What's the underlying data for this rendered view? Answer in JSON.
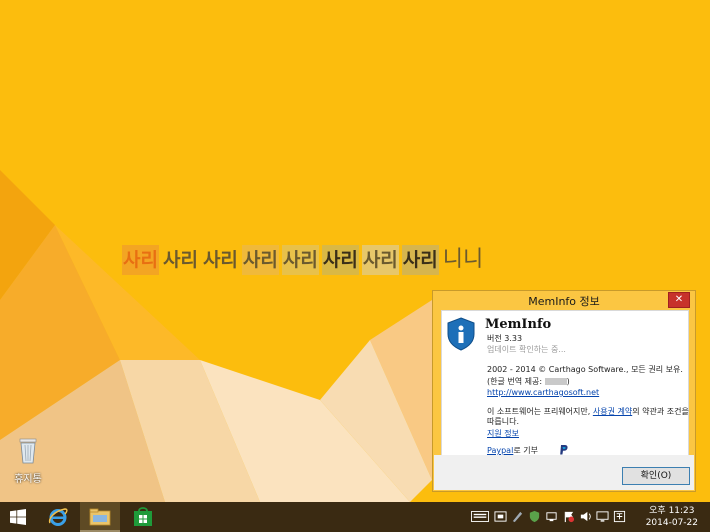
{
  "desktop": {
    "watermark_words": [
      "사리",
      "사리",
      "사리",
      "사리",
      "사리",
      "사리",
      "사리",
      "사리"
    ],
    "watermark_tail": "니니",
    "recycle_bin_label": "휴지통"
  },
  "dialog": {
    "title": "MemInfo 정보",
    "close_glyph": "✕",
    "app_name": "MemInfo",
    "version": "버전 3.33",
    "update_status": "업데이트 확인하는 중...",
    "copyright": "2002 - 2014 © Carthago Software., 모든 권리 보유.",
    "translation_prefix": "(한글 번역 제공: ",
    "translation_suffix": ")",
    "website": "http://www.carthagosoft.net",
    "license_text_1": "이 소프트웨어는 프리웨어지만, ",
    "license_link": "사용권 계약",
    "license_text_2": "의 약관과 조건을",
    "license_text_3": "따릅니다.",
    "support_link": "지원 정보",
    "donate_link": "Paypal",
    "donate_suffix": "로 기부",
    "ok_label": "확인(O)"
  },
  "taskbar": {
    "clock_period_time": "오후 11:23",
    "clock_date": "2014-07-22",
    "icons": [
      "start-icon",
      "internet-explorer-icon",
      "file-explorer-icon",
      "store-icon"
    ],
    "tray_icons": [
      "keyboard-icon",
      "ime-icon",
      "pen-icon",
      "shield-icon",
      "network-icon",
      "flag-icon",
      "volume-icon",
      "monitor-icon",
      "input-icon"
    ]
  },
  "colors": {
    "wallpaper": "#fcbd0d",
    "dialog_frame": "#fbc642",
    "close_red": "#c7322b",
    "taskbar": "#3a2a12",
    "link": "#0645ad"
  }
}
